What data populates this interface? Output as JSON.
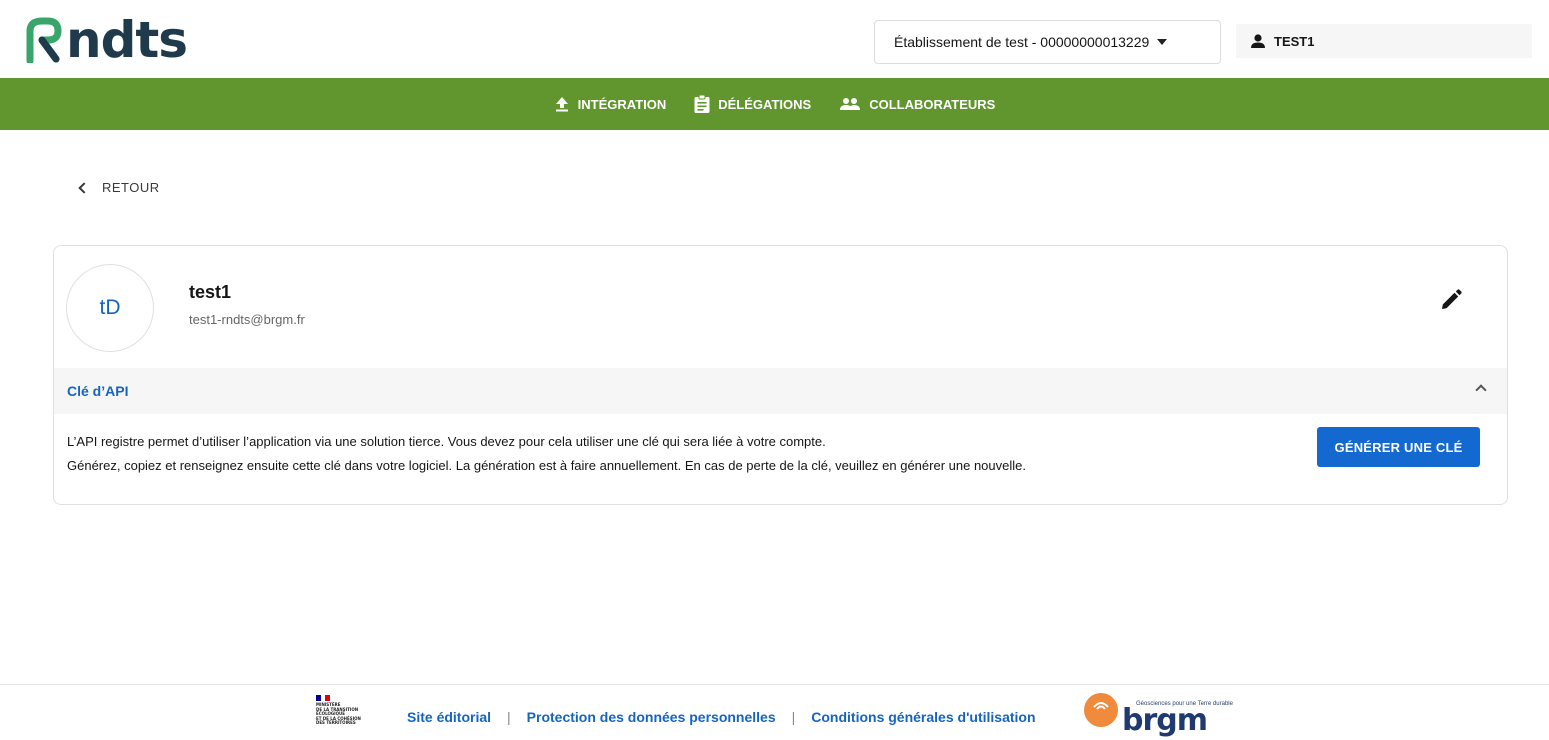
{
  "header": {
    "logo_text": "ndts",
    "establishment": "Établissement de test - 00000000013229",
    "user": "TEST1"
  },
  "nav": {
    "items": [
      {
        "label": "INTÉGRATION",
        "icon": "upload-icon"
      },
      {
        "label": "DÉLÉGATIONS",
        "icon": "clipboard-icon"
      },
      {
        "label": "COLLABORATEURS",
        "icon": "users-icon"
      }
    ]
  },
  "back_label": "RETOUR",
  "profile": {
    "initials": "tD",
    "name": "test1",
    "email": "test1-rndts@brgm.fr"
  },
  "api": {
    "title": "Clé d’API",
    "line1": "L’API registre permet d’utiliser l’application via une solution tierce. Vous devez pour cela utiliser une clé qui sera liée à votre compte.",
    "line2": "Générez, copiez et renseignez ensuite cette clé dans votre logiciel. La génération est à faire annuellement. En cas de perte de la clé, veuillez en générer une nouvelle.",
    "button": "GÉNÉRER UNE CLÉ"
  },
  "footer": {
    "ministere": "MINISTÈRE\nDE LA TRANSITION\nÉCOLOGIQUE\nET DE LA COHÉSION\nDES TERRITOIRES",
    "links": [
      "Site éditorial",
      "Protection des données personnelles",
      "Conditions générales d'utilisation"
    ],
    "separator": "|",
    "brgm_tagline": "Géosciences pour une Terre durable",
    "brgm_word": "brgm"
  },
  "colors": {
    "nav_green": "#61962e",
    "primary_blue": "#1469d0",
    "link_blue": "#1565c0"
  }
}
